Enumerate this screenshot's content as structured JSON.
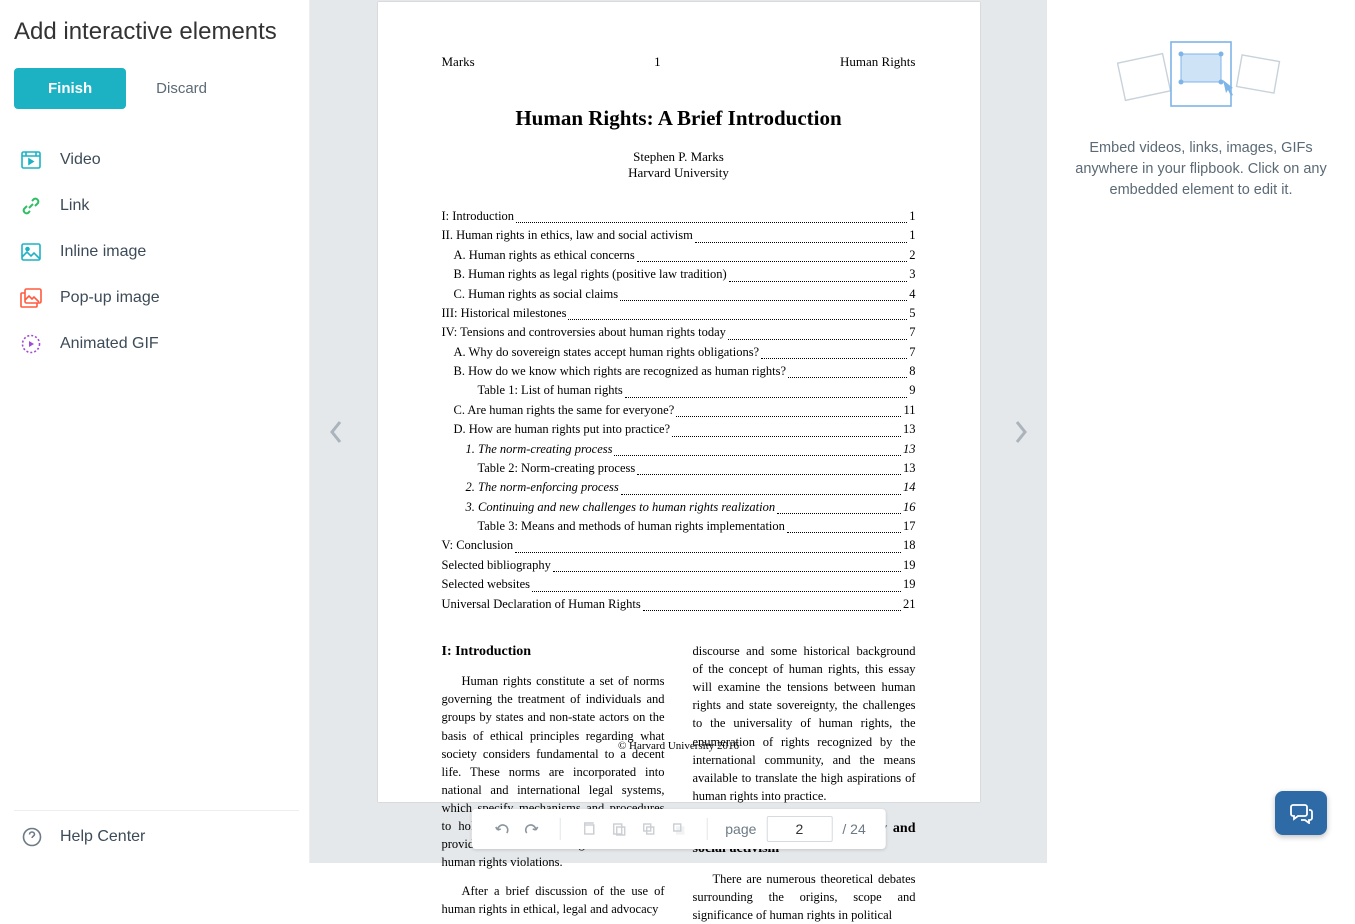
{
  "left": {
    "title": "Add interactive elements",
    "finish": "Finish",
    "discard": "Discard",
    "menu": {
      "video": "Video",
      "link": "Link",
      "inline_image": "Inline image",
      "popup_image": "Pop-up image",
      "animated_gif": "Animated GIF"
    },
    "help_center": "Help Center"
  },
  "doc": {
    "header_left": "Marks",
    "header_center": "1",
    "header_right": "Human Rights",
    "title": "Human Rights:  A Brief Introduction",
    "author": "Stephen P. Marks",
    "affiliation": "Harvard University",
    "toc": [
      {
        "t": "I: Introduction",
        "p": "1",
        "cls": ""
      },
      {
        "t": "II. Human rights in ethics, law and social activism",
        "p": "1",
        "cls": ""
      },
      {
        "t": "A. Human rights as ethical concerns",
        "p": "2",
        "cls": "indent1"
      },
      {
        "t": "B. Human rights as legal rights (positive law tradition)",
        "p": "3",
        "cls": "indent1"
      },
      {
        "t": "C. Human rights as social claims",
        "p": "4",
        "cls": "indent1"
      },
      {
        "t": "III: Historical milestones",
        "p": "5",
        "cls": ""
      },
      {
        "t": "IV: Tensions and controversies about human rights today",
        "p": "7",
        "cls": ""
      },
      {
        "t": "A. Why do sovereign states accept human rights obligations?",
        "p": "7",
        "cls": "indent1"
      },
      {
        "t": "B. How do we know which rights are recognized as human rights?",
        "p": "8",
        "cls": "indent1"
      },
      {
        "t": "Table 1: List of human rights",
        "p": "9",
        "cls": "indent2"
      },
      {
        "t": "C. Are human rights the same for everyone?",
        "p": "11",
        "cls": "indent1"
      },
      {
        "t": "D. How are human rights put into practice?",
        "p": "13",
        "cls": "indent1"
      },
      {
        "t": "1. The norm-creating process",
        "p": "13",
        "cls": "indent3"
      },
      {
        "t": "Table 2: Norm-creating process",
        "p": "13",
        "cls": "indent2"
      },
      {
        "t": "2. The norm-enforcing process",
        "p": "14",
        "cls": "indent3"
      },
      {
        "t": "3. Continuing and new challenges to human rights realization",
        "p": "16",
        "cls": "indent3"
      },
      {
        "t": "Table 3: Means and methods of human rights implementation",
        "p": "17",
        "cls": "indent2"
      },
      {
        "t": "V: Conclusion",
        "p": "18",
        "cls": ""
      },
      {
        "t": "Selected bibliography",
        "p": "19",
        "cls": ""
      },
      {
        "t": "Selected websites",
        "p": "19",
        "cls": ""
      },
      {
        "t": "Universal Declaration of Human Rights",
        "p": "21",
        "cls": ""
      }
    ],
    "section1_head": "I: Introduction",
    "section1_p1": "Human rights constitute a set of norms governing the treatment of individuals and groups by states and non-state actors on the basis of ethical principles regarding what society considers fundamental to a decent life. These norms are incorporated into national and international legal systems, which specify mechanisms and procedures to hold the duty-bearers accountable and provide redress for alleged victims of human rights violations.",
    "section1_p2": "After a brief discussion of the use of human rights in ethical, legal and advocacy",
    "col2_p1": "discourse and some historical background of the concept of human rights, this essay will examine the tensions between human rights and state sovereignty, the challenges to the universality of human rights, the enumeration of rights recognized by the international community, and the means available to translate the high aspirations of human rights into practice.",
    "section2_head": "II. Human rights in ethics, law and social activism",
    "col2_p2": "There are numerous theoretical debates surrounding the origins, scope and significance of human rights in political",
    "copyright": "© Harvard University 2016"
  },
  "toolbar": {
    "page_label": "page",
    "current_page": "2",
    "total": "/ 24"
  },
  "right": {
    "help_text": "Embed videos, links, images, GIFs anywhere in your flipbook. Click on any embedded element to edit it."
  }
}
